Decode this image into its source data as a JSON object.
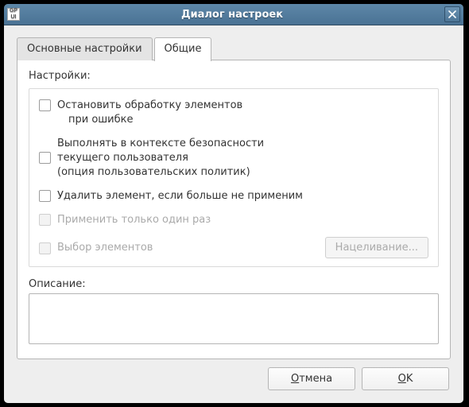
{
  "window": {
    "app_icon": "GPUI",
    "title": "Диалог настроек"
  },
  "tabs": {
    "main": "Основные настройки",
    "common": "Общие"
  },
  "settings_label": "Настройки:",
  "options": {
    "stop_on_error_l1": "Остановить обработку элементов",
    "stop_on_error_l2": "при ошибке",
    "sec_ctx_l1": "Выполнять в контексте безопасности",
    "sec_ctx_l2": "текущего пользователя",
    "sec_ctx_l3": "(опция пользовательских политик)",
    "remove_if_na": "Удалить элемент, если больше не применим",
    "apply_once": "Применить только один раз",
    "item_targeting": "Выбор элементов",
    "targeting_btn": "Нацеливание..."
  },
  "description_label": "Описание:",
  "description_value": "",
  "footer": {
    "cancel": "Отмена",
    "ok": "OK"
  }
}
